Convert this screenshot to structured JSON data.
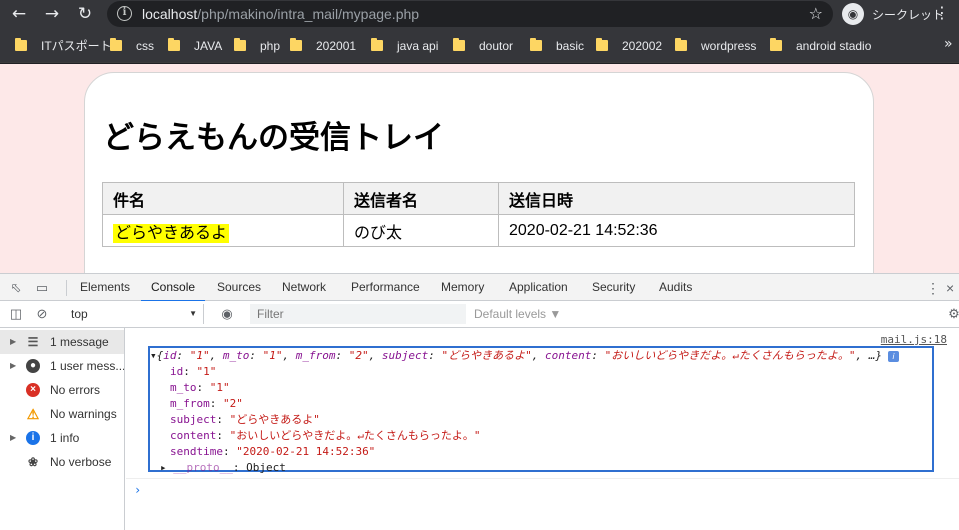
{
  "browser": {
    "url_host": "localhost",
    "url_path": "/php/makino/intra_mail/mypage.php",
    "incognito_label": "シークレット"
  },
  "bookmarks": [
    {
      "label": "ITパスポート"
    },
    {
      "label": "css"
    },
    {
      "label": "JAVA"
    },
    {
      "label": "php"
    },
    {
      "label": "202001"
    },
    {
      "label": "java api"
    },
    {
      "label": "doutor"
    },
    {
      "label": "basic"
    },
    {
      "label": "202002"
    },
    {
      "label": "wordpress"
    },
    {
      "label": "android stadio"
    }
  ],
  "page": {
    "title": "どらえもんの受信トレイ",
    "table": {
      "headers": [
        "件名",
        "送信者名",
        "送信日時"
      ],
      "rows": [
        [
          "どらやきあるよ",
          "のび太",
          "2020-02-21 14:52:36"
        ]
      ]
    }
  },
  "devtools": {
    "tabs": [
      "Elements",
      "Console",
      "Sources",
      "Network",
      "Performance",
      "Memory",
      "Application",
      "Security",
      "Audits"
    ],
    "active_tab": "Console",
    "context": "top",
    "filter_placeholder": "Filter",
    "levels_label": "Default levels ▼",
    "sidebar": [
      {
        "label": "1 message",
        "icon": "list-icon"
      },
      {
        "label": "1 user mess...",
        "icon": "user-icon"
      },
      {
        "label": "No errors",
        "icon": "error-icon"
      },
      {
        "label": "No warnings",
        "icon": "warning-icon"
      },
      {
        "label": "1 info",
        "icon": "info-icon"
      },
      {
        "label": "No verbose",
        "icon": "bug-icon"
      }
    ],
    "console": {
      "source": "mail.js:18",
      "summary": {
        "open": "{",
        "id_key": "id",
        "id_val": "\"1\"",
        "m_to_key": "m_to",
        "m_to_val": "\"1\"",
        "m_from_key": "m_from",
        "m_from_val": "\"2\"",
        "subject_key": "subject",
        "subject_val": "\"どらやきあるよ\"",
        "content_key": "content",
        "content_val": "\"おいしいどらやきだよ。↵たくさんもらったよ。\"",
        "tail": ", …}"
      },
      "props": [
        {
          "key": "id",
          "value": "\"1\""
        },
        {
          "key": "m_to",
          "value": "\"1\""
        },
        {
          "key": "m_from",
          "value": "\"2\""
        },
        {
          "key": "subject",
          "value": "\"どらやきあるよ\""
        },
        {
          "key": "content",
          "value": "\"おいしいどらやきだよ。↵たくさんもらったよ。\""
        },
        {
          "key": "sendtime",
          "value": "\"2020-02-21 14:52:36\""
        }
      ],
      "proto_key": "__proto__",
      "proto_val": "Object"
    }
  }
}
